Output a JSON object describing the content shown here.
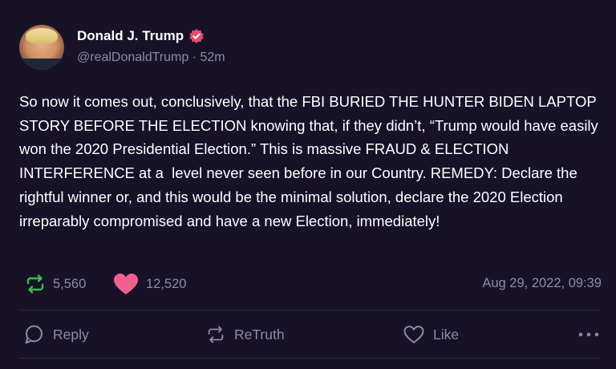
{
  "author": {
    "display_name": "Donald J. Trump",
    "handle": "@realDonaldTrump",
    "separator": "·",
    "time_ago": "52m",
    "verified_badge_color": "#e44d6a"
  },
  "post": {
    "text": "So now it comes out, conclusively, that the FBI BURIED THE HUNTER BIDEN LAPTOP STORY BEFORE THE ELECTION knowing that, if they didn’t, “Trump would have easily won the 2020 Presidential Election.” This is massive FRAUD & ELECTION INTERFERENCE at a  level never seen before in our Country. REMEDY: Declare the rightful winner or, and this would be the minimal solution, declare the 2020 Election irreparably compromised and have a new Election, immediately!"
  },
  "stats": {
    "retruth_count": "5,560",
    "like_count": "12,520",
    "timestamp": "Aug 29, 2022, 09:39"
  },
  "actions": {
    "reply_label": "Reply",
    "retruth_label": "ReTruth",
    "like_label": "Like"
  },
  "colors": {
    "background": "#171227",
    "retruth_green": "#3fb950",
    "like_pink": "#f0608e",
    "muted": "#8f8ba6"
  },
  "icons": {
    "verified": "verified-badge-icon",
    "retruth": "retruth-icon",
    "like": "heart-icon",
    "reply": "reply-icon",
    "more": "more-icon"
  }
}
